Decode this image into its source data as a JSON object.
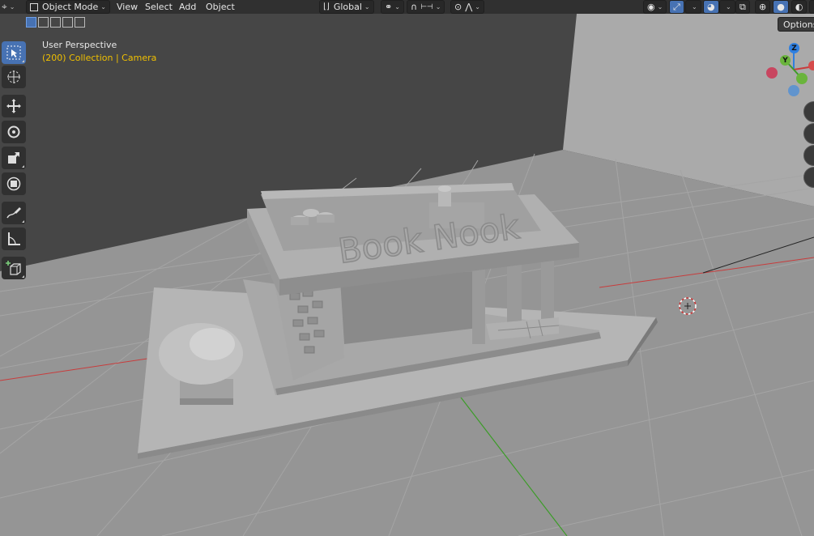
{
  "header": {
    "mode": "Object Mode",
    "menus": [
      "View",
      "Select",
      "Add",
      "Object"
    ],
    "orientation": "Global"
  },
  "overlay": {
    "view_name": "User Perspective",
    "collection_info": "(200) Collection | Camera"
  },
  "scene": {
    "sign_text": "Book Nook"
  },
  "options_label": "Options",
  "gizmo": {
    "z": "Z",
    "y": "Y"
  },
  "tools": [
    {
      "name": "select-box-tool"
    },
    {
      "name": "cursor-tool"
    },
    {
      "name": "move-tool"
    },
    {
      "name": "rotate-tool"
    },
    {
      "name": "scale-tool"
    },
    {
      "name": "transform-tool"
    },
    {
      "name": "annotate-tool"
    },
    {
      "name": "measure-tool"
    },
    {
      "name": "add-cube-tool"
    }
  ],
  "colors": {
    "accent": "#4772b3",
    "highlight_text": "#f0c000",
    "x_axis": "#c83c3c",
    "y_axis": "#3c9c28",
    "z_axis": "#2f7fe0"
  }
}
